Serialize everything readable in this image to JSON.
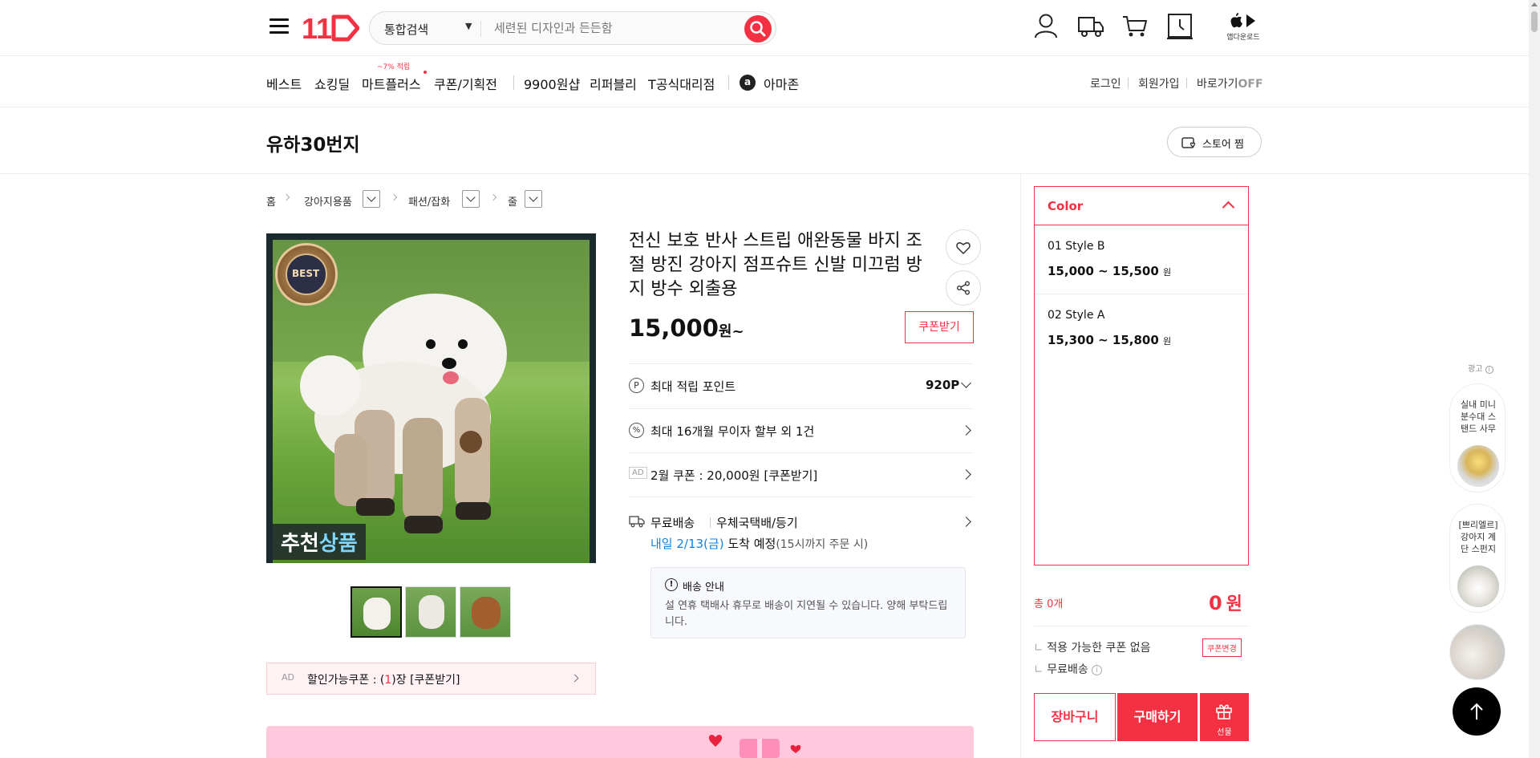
{
  "header": {
    "logo_text": "11",
    "search": {
      "category": "통합검색",
      "placeholder": "세련된 디자인과 든든함"
    },
    "app_download": "앱다운로드"
  },
  "gnb": {
    "items": [
      "베스트",
      "쇼킹딜",
      "마트플러스",
      "쿠폰/기획전",
      "9900원샵",
      "리퍼블리",
      "T공식대리점",
      "아마존"
    ],
    "mart_badge": "~7% 적립",
    "amazon_mark": "a"
  },
  "util": {
    "login": "로그인",
    "join": "회원가입",
    "shortcut": "바로가기",
    "shortcut_state": "OFF"
  },
  "store": {
    "name": "유하30번지",
    "follow_label": "스토어 찜"
  },
  "breadcrumb": [
    "홈",
    "강아지용품",
    "패션/잡화",
    "줄"
  ],
  "product": {
    "title": "전신 보호 반사 스트립 애완동물 바지 조절 방진 강아지 점프슈트 신발 미끄럼 방지 방수 외출용",
    "price": "15,000",
    "price_unit": "원~",
    "coupon_btn": "쿠폰받기",
    "image_badge": "BEST",
    "image_caption_1": "추천",
    "image_caption_2": "상품",
    "points_label": "최대 적립 포인트",
    "points_value": "920P",
    "installment": "최대 16개월 무이자 할부 외 1건",
    "ad_tag": "AD",
    "coupon_event": "2월 쿠폰 : 20,000원 [쿠폰받기]",
    "delivery_free": "무료배송",
    "delivery_method": "우체국택배/등기",
    "delivery_date_prefix": "내일 2/13(금)",
    "delivery_date_suffix": "도착 예정",
    "delivery_date_note": "(15시까지 주문 시)",
    "notice_title": "배송 안내",
    "notice_text": "설 연휴 택배사 휴무로 배송이 지연될 수 있습니다. 양해 부탁드립니다.",
    "discount_coupon_ad": "AD",
    "discount_coupon_prefix": "할인가능쿠폰 : (",
    "discount_coupon_count": "1",
    "discount_coupon_suffix": ")장 [쿠폰받기]"
  },
  "options": {
    "title": "Color",
    "items": [
      {
        "name": "01 Style B",
        "price": "15,000 ~ 15,500",
        "unit": "원"
      },
      {
        "name": "02 Style A",
        "price": "15,300 ~ 15,800",
        "unit": "원"
      }
    ]
  },
  "summary": {
    "total_label": "총 0개",
    "total_value": "0",
    "total_unit": "원",
    "coupon_none": "적용 가능한 쿠폰 없음",
    "coupon_change": "쿠폰변경",
    "free_shipping": "무료배송",
    "cart_btn": "장바구니",
    "buy_btn": "구매하기",
    "gift_btn": "선물"
  },
  "side_ads": {
    "label": "광고",
    "items": [
      {
        "text": "실내 미니 분수대 스탠드 사무"
      },
      {
        "text": "[쁘리엘르] 강아지 계단 스펀지"
      }
    ]
  },
  "colors": {
    "accent": "#f43142",
    "link_blue": "#0b83e6"
  }
}
